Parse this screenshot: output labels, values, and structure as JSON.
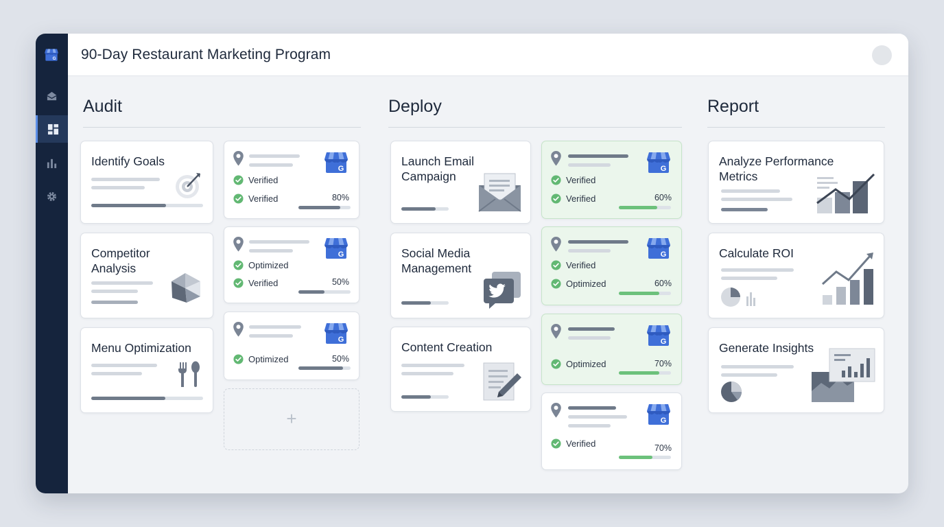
{
  "app": {
    "title": "90-Day Restaurant Marketing Program"
  },
  "columns": {
    "audit": {
      "title": "Audit",
      "tasks": [
        "Identify Goals",
        "Competitor\nAnalysis",
        "Menu Optimization"
      ],
      "listings": [
        {
          "status1": "Verified",
          "status2": "Verified",
          "pct": "80%",
          "progress": 0.8
        },
        {
          "status1": "Optimized",
          "status2": "Verified",
          "pct": "50%",
          "progress": 0.5
        },
        {
          "status1": "Optimized",
          "pct": "50%",
          "progress": 0.85
        }
      ],
      "add_label": "+"
    },
    "deploy": {
      "title": "Deploy",
      "tasks": [
        "Launch Email\nCampaign",
        "Social Media\nManagement",
        "Content Creation"
      ],
      "listings": [
        {
          "status1": "Verified",
          "status2": "Verified",
          "pct": "60%",
          "progress": 0.74
        },
        {
          "status1": "Verified",
          "status2": "Optimized",
          "pct": "60%",
          "progress": 0.78
        },
        {
          "status1": "Optimized",
          "pct": "70%",
          "progress": 0.78
        },
        {
          "status1": "Verified",
          "pct": "70%",
          "progress": 0.64
        }
      ]
    },
    "report": {
      "title": "Report",
      "tasks": [
        "Analyze Performance\nMetrics",
        "Calculate ROI",
        "Generate Insights"
      ]
    }
  },
  "colors": {
    "sidebar": "#15243d",
    "accent": "#5b8ee6",
    "success": "#6cc17b",
    "brand_blue": "#3f6fd8"
  },
  "icons": [
    "store-icon",
    "inbox-icon",
    "dashboard-icon",
    "bar-chart-icon",
    "gear-icon",
    "map-pin-icon",
    "check-icon",
    "google-business-icon",
    "target-icon",
    "pie-icon",
    "utensils-icon",
    "envelope-icon",
    "twitter-icon",
    "document-edit-icon",
    "trend-chart-icon",
    "plus-icon"
  ]
}
